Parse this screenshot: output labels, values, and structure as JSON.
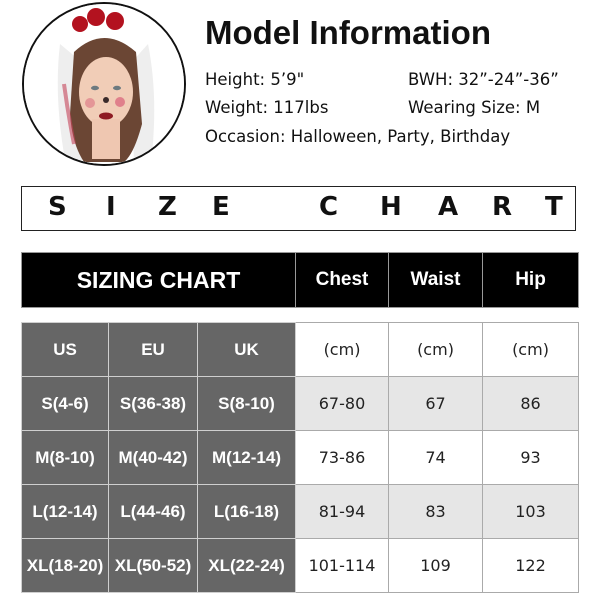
{
  "model": {
    "title": "Model Information",
    "height": "Height: 5’9\"",
    "bwh": "BWH: 32”-24”-36”",
    "weight": "Weight: 117lbs",
    "wearing_size": "Wearing Size: M",
    "occasion": "Occasion: Halloween, Party, Birthday",
    "photo": "model-photo-bride-veil-rose-headband"
  },
  "banner": {
    "letters_left": [
      "S",
      "I",
      "Z",
      "E"
    ],
    "letters_right": [
      "C",
      "H",
      "A",
      "R",
      "T"
    ]
  },
  "table": {
    "header": {
      "sizing": "SIZING CHART",
      "chest": "Chest",
      "waist": "Waist",
      "hip": "Hip"
    },
    "subheader": {
      "us": "US",
      "eu": "EU",
      "uk": "UK",
      "chest_unit": "(cm)",
      "waist_unit": "(cm)",
      "hip_unit": "(cm)"
    },
    "rows": [
      {
        "us": "S(4-6)",
        "eu": "S(36-38)",
        "uk": "S(8-10)",
        "chest": "67-80",
        "waist": "67",
        "hip": "86"
      },
      {
        "us": "M(8-10)",
        "eu": "M(40-42)",
        "uk": "M(12-14)",
        "chest": "73-86",
        "waist": "74",
        "hip": "93"
      },
      {
        "us": "L(12-14)",
        "eu": "L(44-46)",
        "uk": "L(16-18)",
        "chest": "81-94",
        "waist": "83",
        "hip": "103"
      },
      {
        "us": "XL(18-20)",
        "eu": "XL(50-52)",
        "uk": "XL(22-24)",
        "chest": "101-114",
        "waist": "109",
        "hip": "122"
      }
    ]
  },
  "colors": {
    "header_bg": "#000000",
    "size_col_bg": "#666666",
    "alt_row_bg": "#e6e6e6"
  }
}
